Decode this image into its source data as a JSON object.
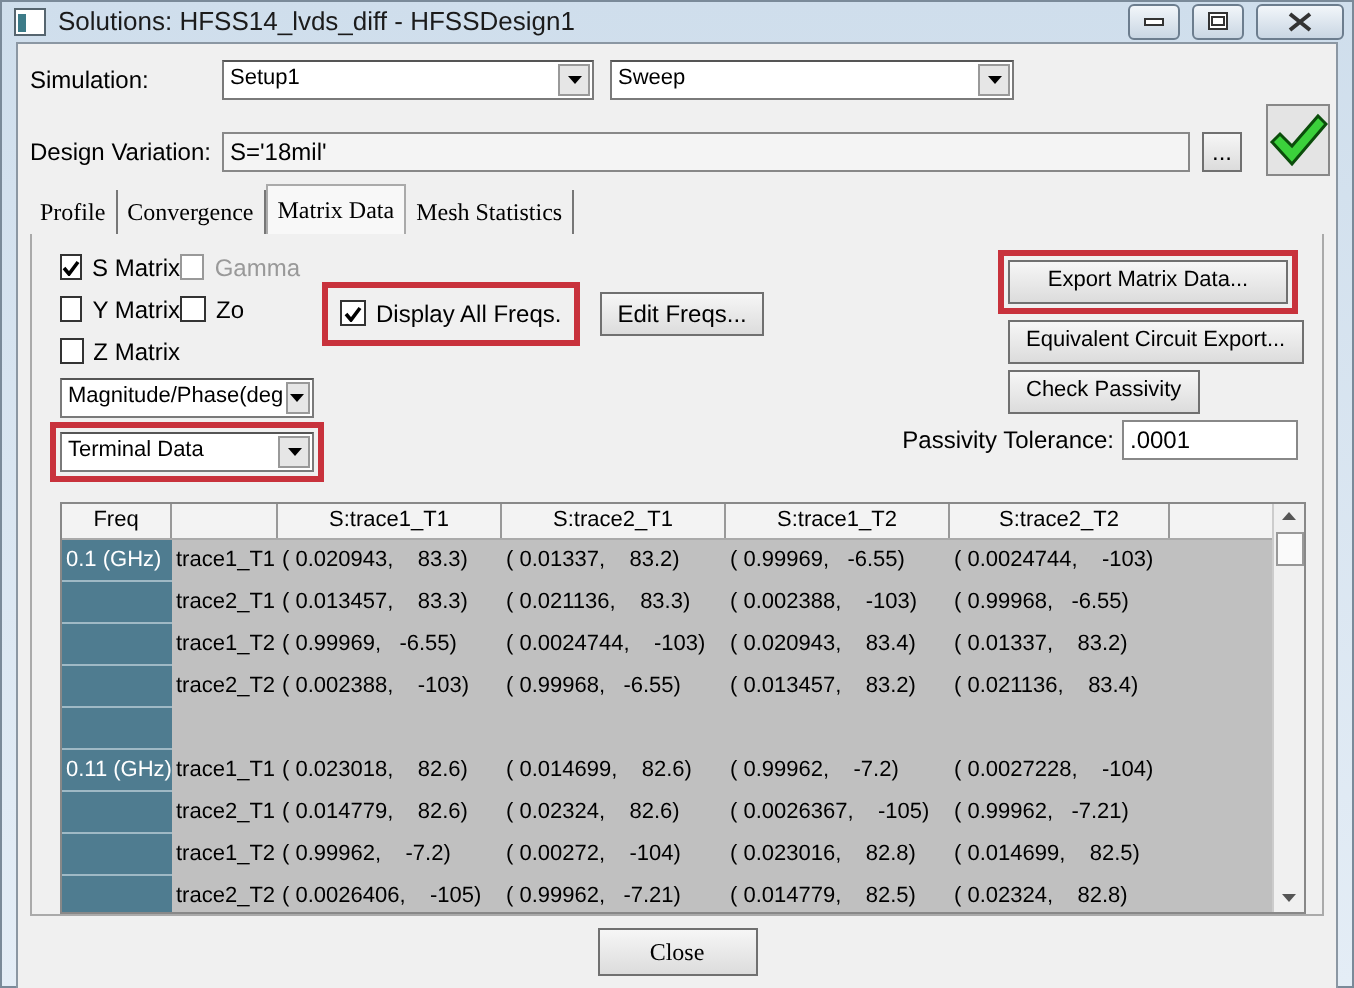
{
  "window": {
    "title": "Solutions: HFSS14_lvds_diff - HFSSDesign1"
  },
  "simulation": {
    "label": "Simulation:",
    "setup": "Setup1",
    "sweep": "Sweep"
  },
  "design_variation": {
    "label": "Design Variation:",
    "value": "S='18mil'",
    "browse": "..."
  },
  "tabs": [
    {
      "label": "Profile",
      "selected": false
    },
    {
      "label": "Convergence",
      "selected": false
    },
    {
      "label": "Matrix Data",
      "selected": true
    },
    {
      "label": "Mesh Statistics",
      "selected": false
    }
  ],
  "matrix_options": [
    {
      "label": "S Matrix",
      "checked": true,
      "disabled": false
    },
    {
      "label": "Gamma",
      "checked": false,
      "disabled": true
    },
    {
      "label": "Y Matrix",
      "checked": false,
      "disabled": false
    },
    {
      "label": "Zo",
      "checked": false,
      "disabled": false
    },
    {
      "label": "Z Matrix",
      "checked": false,
      "disabled": false
    }
  ],
  "format_dropdown": {
    "value": "Magnitude/Phase(deg"
  },
  "data_dropdown": {
    "value": "Terminal Data",
    "highlighted": true
  },
  "display_all_freqs": {
    "label": "Display All Freqs.",
    "checked": true,
    "highlighted": true
  },
  "edit_freqs": {
    "label": "Edit Freqs..."
  },
  "actions": [
    {
      "label": "Export Matrix Data...",
      "highlighted": true
    },
    {
      "label": "Equivalent Circuit Export...",
      "highlighted": false
    },
    {
      "label": "Check Passivity",
      "highlighted": false
    }
  ],
  "passivity": {
    "label": "Passivity Tolerance:",
    "value": ".0001"
  },
  "table": {
    "columns": [
      "Freq",
      "S:trace1_T1",
      "S:trace2_T1",
      "S:trace1_T2",
      "S:trace2_T2"
    ],
    "groups": [
      {
        "freq": "0.1 (GHz)",
        "rows": [
          {
            "port": "trace1_T1",
            "values": [
              "( 0.020943,    83.3)",
              "( 0.01337,    83.2)",
              "( 0.99969,   -6.55)",
              "( 0.0024744,    -103)"
            ]
          },
          {
            "port": "trace2_T1",
            "values": [
              "( 0.013457,    83.3)",
              "( 0.021136,    83.3)",
              "( 0.002388,    -103)",
              "( 0.99968,   -6.55)"
            ]
          },
          {
            "port": "trace1_T2",
            "values": [
              "( 0.99969,   -6.55)",
              "( 0.0024744,    -103)",
              "( 0.020943,    83.4)",
              "( 0.01337,    83.2)"
            ]
          },
          {
            "port": "trace2_T2",
            "values": [
              "( 0.002388,    -103)",
              "( 0.99968,   -6.55)",
              "( 0.013457,    83.2)",
              "( 0.021136,    83.4)"
            ]
          }
        ]
      },
      {
        "freq": "0.11 (GHz)",
        "rows": [
          {
            "port": "trace1_T1",
            "values": [
              "( 0.023018,    82.6)",
              "( 0.014699,    82.6)",
              "( 0.99962,    -7.2)",
              "( 0.0027228,    -104)"
            ]
          },
          {
            "port": "trace2_T1",
            "values": [
              "( 0.014779,    82.6)",
              "( 0.02324,    82.6)",
              "( 0.0026367,    -105)",
              "( 0.99962,   -7.21)"
            ]
          },
          {
            "port": "trace1_T2",
            "values": [
              "( 0.99962,    -7.2)",
              "( 0.00272,    -104)",
              "( 0.023016,    82.8)",
              "( 0.014699,    82.5)"
            ]
          },
          {
            "port": "trace2_T2",
            "values": [
              "( 0.0026406,    -105)",
              "( 0.99962,   -7.21)",
              "( 0.014779,    82.5)",
              "( 0.02324,    82.8)"
            ]
          }
        ]
      }
    ]
  },
  "close_button": "Close"
}
